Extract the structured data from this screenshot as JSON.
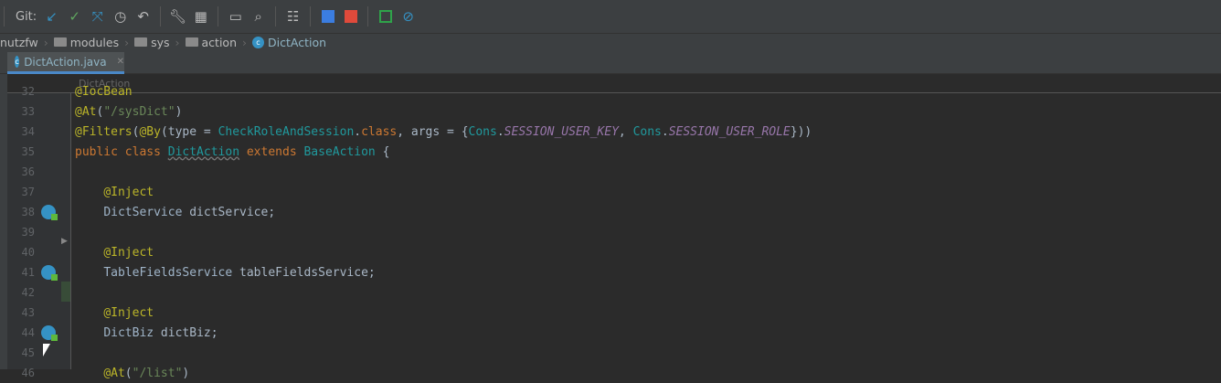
{
  "toolbar": {
    "git_label": "Git:",
    "icons": [
      "update-project-icon",
      "commit-icon",
      "merge-icon",
      "history-icon",
      "revert-icon",
      "settings-wrench-icon",
      "project-structure-icon",
      "terminal-icon",
      "search-icon",
      "sdk-icon",
      "translate-icon",
      "translate-2-icon",
      "plugin-icon",
      "compass-icon"
    ]
  },
  "breadcrumb": [
    "nutzfw",
    "modules",
    "sys",
    "action",
    "DictAction"
  ],
  "tab": {
    "label": "DictAction.java"
  },
  "editor_header": "DictAction",
  "lines": [
    {
      "n": "32",
      "html": "<span class='ann'>@IocBean</span>"
    },
    {
      "n": "33",
      "html": "<span class='ann'>@At</span>(<span class='str'>\"/sysDict\"</span>)"
    },
    {
      "n": "34",
      "html": "<span class='ann'>@Filters</span>(<span class='ann'>@By</span>(type = <span class='cls'>CheckRoleAndSession</span>.<span class='kw'>class</span>, args = {<span class='cls'>Cons</span>.<span class='con'>SESSION_USER_KEY</span>, <span class='cls'>Cons</span>.<span class='con'>SESSION_USER_ROLE</span>}))"
    },
    {
      "n": "35",
      "html": "<span class='kw'>public class</span> <span class='cls' style='text-decoration:underline wavy #777'>DictAction</span> <span class='kw'>extends</span> <span class='cls'>BaseAction</span> {"
    },
    {
      "n": "36",
      "html": ""
    },
    {
      "n": "37",
      "html": "    <span class='ann'>@Inject</span>"
    },
    {
      "n": "38",
      "html": "    <span class='typ'>DictService</span> dictService;",
      "icon": true
    },
    {
      "n": "39",
      "html": ""
    },
    {
      "n": "40",
      "html": "    <span class='ann'>@Inject</span>"
    },
    {
      "n": "41",
      "html": "    <span class='typ'>TableFieldsService</span> tableFieldsService;",
      "icon": true
    },
    {
      "n": "42",
      "html": ""
    },
    {
      "n": "43",
      "html": "    <span class='ann'>@Inject</span>"
    },
    {
      "n": "44",
      "html": "    <span class='typ'>DictBiz</span> dictBiz;",
      "icon": true
    },
    {
      "n": "45",
      "html": ""
    },
    {
      "n": "46",
      "html": "    <span class='ann'>@At</span>(<span class='str'>\"/list\"</span>)"
    }
  ]
}
